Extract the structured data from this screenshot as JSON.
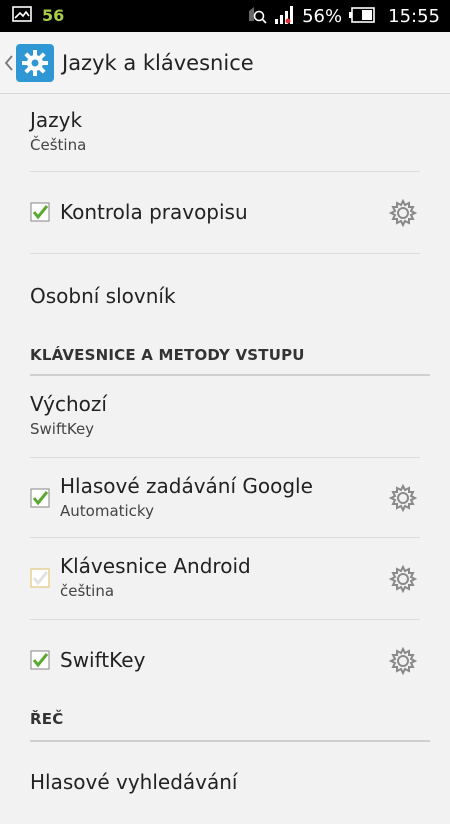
{
  "status_bar": {
    "notification_count": "56",
    "battery_percent": "56%",
    "time": "15:55",
    "icons": [
      "gallery-icon",
      "sync-search-icon",
      "signal-icon",
      "battery-icon"
    ]
  },
  "action_bar": {
    "title": "Jazyk a klávesnice",
    "icon": "settings-gear-icon",
    "accent_color": "#2f97d4"
  },
  "rows": {
    "language": {
      "title": "Jazyk",
      "subtitle": "Čeština"
    },
    "spellcheck": {
      "title": "Kontrola pravopisu",
      "checked": true
    },
    "dictionary": {
      "title": "Osobní slovník"
    }
  },
  "sections": {
    "keyboard": {
      "title": "KLÁVESNICE A METODY VSTUPU"
    },
    "speech": {
      "title": "ŘEČ"
    }
  },
  "keyboard_rows": {
    "default": {
      "title": "Výchozí",
      "subtitle": "SwiftKey"
    },
    "google_voice": {
      "title": "Hlasové zadávání Google",
      "subtitle": "Automaticky",
      "checked": true
    },
    "android_keyboard": {
      "title": "Klávesnice Android",
      "subtitle": "čeština",
      "checked": true,
      "disabled": true
    },
    "swiftkey": {
      "title": "SwiftKey",
      "checked": true
    }
  },
  "speech_rows": {
    "voice_search": {
      "title": "Hlasové vyhledávání"
    }
  },
  "colors": {
    "check_green": "#5aa832",
    "check_disabled": "#e3c97a",
    "gear_gray": "#8a8a8a"
  }
}
